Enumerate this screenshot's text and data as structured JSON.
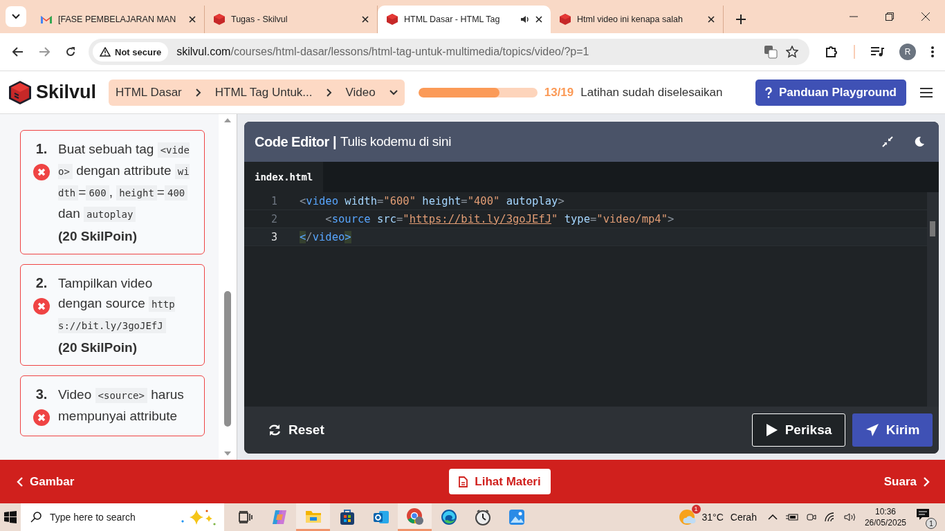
{
  "browser": {
    "tabs": [
      {
        "title": "[FASE PEMBELAJARAN MAN",
        "selected": false,
        "audio": false
      },
      {
        "title": "Tugas - Skilvul",
        "selected": false,
        "audio": false
      },
      {
        "title": "HTML Dasar - HTML Tag",
        "selected": true,
        "audio": true
      },
      {
        "title": "Html video ini kenapa salah",
        "selected": false,
        "audio": false
      }
    ],
    "security": "Not secure",
    "url_host": "skilvul.com",
    "url_path": "/courses/html-dasar/lessons/html-tag-untuk-multimedia/topics/video/?p=1",
    "profile": "R"
  },
  "header": {
    "logo": "Skilvul",
    "breadcrumbs": [
      "HTML Dasar",
      "HTML Tag Untuk...",
      "Video"
    ],
    "progress": {
      "level": 0.68,
      "count": "13/19",
      "label": "Latihan sudah diselesaikan"
    },
    "guide_button": "Panduan Playground"
  },
  "tasks": [
    {
      "number": "1.",
      "passed": false,
      "parts": [
        {
          "kind": "text",
          "text": "Buat sebuah tag "
        },
        {
          "kind": "code",
          "text": "<video>"
        },
        {
          "kind": "text",
          "text": " dengan attribute "
        },
        {
          "kind": "code",
          "text": "width"
        },
        {
          "kind": "text",
          "text": "="
        },
        {
          "kind": "code",
          "text": "600"
        },
        {
          "kind": "text",
          "text": ", "
        },
        {
          "kind": "code",
          "text": "height"
        },
        {
          "kind": "text",
          "text": "="
        },
        {
          "kind": "code",
          "text": "400"
        },
        {
          "kind": "text",
          "text": " dan "
        },
        {
          "kind": "code",
          "text": "autoplay"
        }
      ],
      "points": "(20 SkilPoin)"
    },
    {
      "number": "2.",
      "passed": false,
      "parts": [
        {
          "kind": "text",
          "text": "Tampilkan video dengan source "
        },
        {
          "kind": "code",
          "text": "https://bit.ly/3goJEfJ"
        }
      ],
      "points": "(20 SkilPoin)"
    },
    {
      "number": "3.",
      "passed": false,
      "parts": [
        {
          "kind": "text",
          "text": "Video "
        },
        {
          "kind": "code",
          "text": "<source>"
        },
        {
          "kind": "text",
          "text": " harus mempunyai attribute"
        }
      ]
    }
  ],
  "editor": {
    "title": "Code Editor |",
    "subtitle": "Tulis kodemu di sini",
    "file_tab": "index.html",
    "lines": [
      {
        "number": "1",
        "active": false,
        "tokens": [
          {
            "kind": "punct",
            "text": "<"
          },
          {
            "kind": "tag",
            "text": "video"
          },
          {
            "kind": "attr",
            "text": " width"
          },
          {
            "kind": "punct",
            "text": "="
          },
          {
            "kind": "str",
            "text": "\"600\""
          },
          {
            "kind": "attr",
            "text": " height"
          },
          {
            "kind": "punct",
            "text": "="
          },
          {
            "kind": "str",
            "text": "\"400\""
          },
          {
            "kind": "attr",
            "text": " autoplay"
          },
          {
            "kind": "punct",
            "text": ">"
          }
        ]
      },
      {
        "number": "2",
        "active": false,
        "tokens": [
          {
            "kind": "punct",
            "text": "    <"
          },
          {
            "kind": "tag",
            "text": "source"
          },
          {
            "kind": "attr",
            "text": " src"
          },
          {
            "kind": "punct",
            "text": "="
          },
          {
            "kind": "str",
            "text": "\""
          },
          {
            "kind": "link",
            "text": "https://bit.ly/3goJEfJ"
          },
          {
            "kind": "str",
            "text": "\""
          },
          {
            "kind": "attr",
            "text": " type"
          },
          {
            "kind": "punct",
            "text": "="
          },
          {
            "kind": "str",
            "text": "\"video/mp4\""
          },
          {
            "kind": "punct",
            "text": ">"
          }
        ]
      },
      {
        "number": "3",
        "active": true,
        "tokens": [
          {
            "kind": "bracket",
            "text": "<"
          },
          {
            "kind": "punct",
            "text": "/"
          },
          {
            "kind": "tag",
            "text": "video"
          },
          {
            "kind": "bracket",
            "text": ">"
          }
        ]
      }
    ],
    "reset": "Reset",
    "check": "Periksa",
    "submit": "Kirim"
  },
  "footer": {
    "prev": "Gambar",
    "materials": "Lihat Materi",
    "next": "Suara"
  },
  "taskbar": {
    "search": "Type here to search",
    "apps": [
      {
        "kind": "taskview",
        "running": false
      },
      {
        "kind": "copilot",
        "running": false
      },
      {
        "kind": "explorer",
        "running": true
      },
      {
        "kind": "store",
        "running": false
      },
      {
        "kind": "outlook",
        "running": false
      },
      {
        "kind": "chrome",
        "running": true
      },
      {
        "kind": "edge",
        "running": false
      },
      {
        "kind": "clock",
        "running": false
      },
      {
        "kind": "photos",
        "running": false
      }
    ],
    "weather_badge": "1",
    "temperature": "31°C",
    "condition": "Cerah",
    "time": "10:36",
    "date": "26/05/2025",
    "notifications": "1"
  }
}
